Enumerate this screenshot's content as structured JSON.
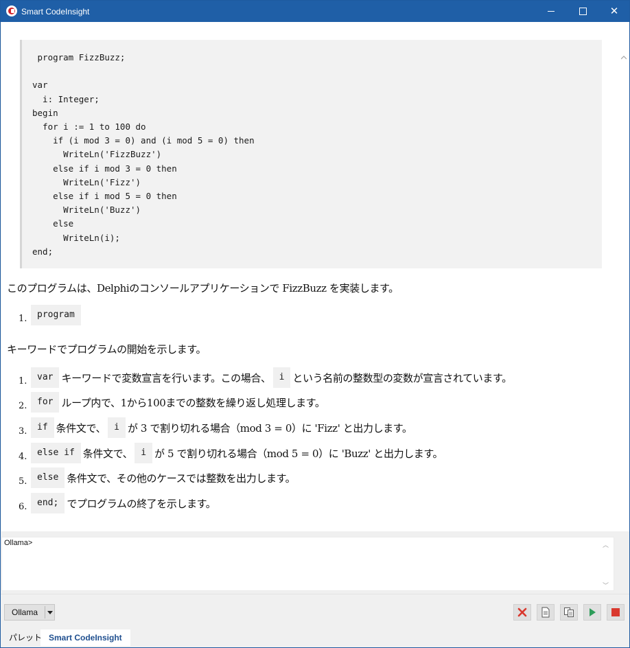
{
  "window": {
    "title": "Smart CodeInsight"
  },
  "code_block": {
    "text": " program FizzBuzz;\n\nvar\n  i: Integer;\nbegin\n  for i := 1 to 100 do\n    if (i mod 3 = 0) and (i mod 5 = 0) then\n      WriteLn('FizzBuzz')\n    else if i mod 3 = 0 then\n      WriteLn('Fizz')\n    else if i mod 5 = 0 then\n      WriteLn('Buzz')\n    else\n      WriteLn(i);\nend;"
  },
  "explanation": {
    "intro": "このプログラムは、Delphiのコンソールアプリケーションで FizzBuzz を実装します。",
    "list1": [
      {
        "num": "1.",
        "code": "program",
        "text": ""
      }
    ],
    "middle": "キーワードでプログラムの開始を示します。",
    "list2": [
      {
        "num": "1.",
        "code": "var",
        "text": "キーワードで変数宣言を行います。この場合、",
        "code2": "i",
        "text2": "という名前の整数型の変数が宣言されています。"
      },
      {
        "num": "2.",
        "code": "for",
        "text": "ループ内で、1から100までの整数を繰り返し処理します。"
      },
      {
        "num": "3.",
        "code": "if",
        "text": "条件文で、",
        "code2": "i",
        "text2": "が 3 で割り切れる場合（mod 3 = 0）に 'Fizz' と出力します。"
      },
      {
        "num": "4.",
        "code": "else if",
        "text": "条件文で、",
        "code2": "i",
        "text2": "が 5 で割り切れる場合（mod 5 = 0）に 'Buzz' と出力します。"
      },
      {
        "num": "5.",
        "code": "else",
        "text": "条件文で、その他のケースでは整数を出力します。"
      },
      {
        "num": "6.",
        "code": "end;",
        "text": "でプログラムの終了を示します。"
      }
    ]
  },
  "input": {
    "value": "Ollama>"
  },
  "toolbar": {
    "model_select": "Ollama"
  },
  "tabs": [
    {
      "label": "パレット"
    },
    {
      "label": "Smart CodeInsight"
    }
  ],
  "colors": {
    "titlebar": "#1f5fa7",
    "stop": "#d9382e",
    "run": "#2e9d5a"
  }
}
